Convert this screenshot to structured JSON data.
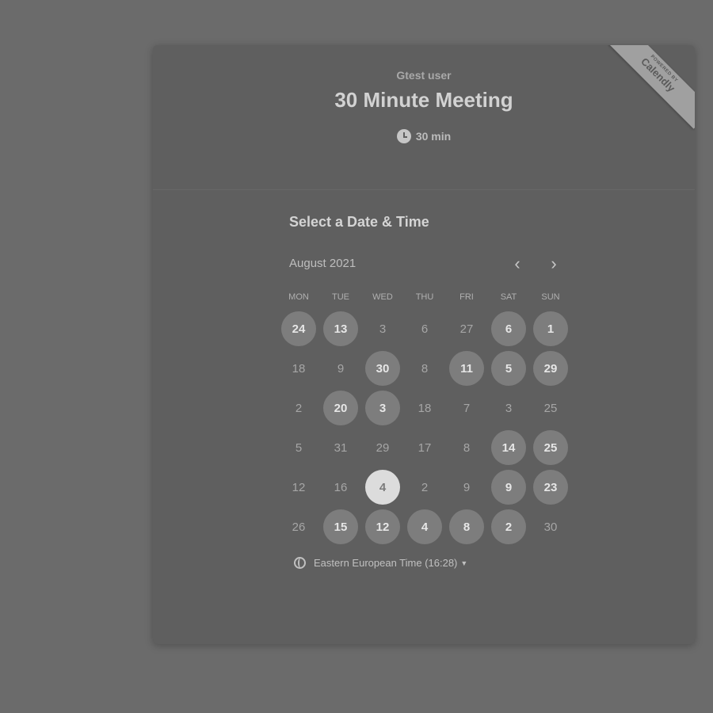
{
  "header": {
    "organizer": "Gtest user",
    "event_title": "30 Minute Meeting",
    "duration": "30 min",
    "ribbon_small": "POWERED BY",
    "ribbon_brand": "Calendly"
  },
  "calendar": {
    "section_title": "Select a Date & Time",
    "month": "August 2021",
    "prev_icon": "‹",
    "next_icon": "›",
    "weekdays": [
      "MON",
      "TUE",
      "WED",
      "THU",
      "FRI",
      "SAT",
      "SUN"
    ],
    "weeks": [
      [
        {
          "label": "24",
          "state": "available"
        },
        {
          "label": "13",
          "state": "available"
        },
        {
          "label": "3",
          "state": "disabled"
        },
        {
          "label": "6",
          "state": "disabled"
        },
        {
          "label": "27",
          "state": "disabled"
        },
        {
          "label": "6",
          "state": "available"
        },
        {
          "label": "1",
          "state": "available"
        }
      ],
      [
        {
          "label": "18",
          "state": "disabled"
        },
        {
          "label": "9",
          "state": "disabled"
        },
        {
          "label": "30",
          "state": "available"
        },
        {
          "label": "8",
          "state": "disabled"
        },
        {
          "label": "11",
          "state": "available"
        },
        {
          "label": "5",
          "state": "available"
        },
        {
          "label": "29",
          "state": "available"
        }
      ],
      [
        {
          "label": "2",
          "state": "disabled"
        },
        {
          "label": "20",
          "state": "available"
        },
        {
          "label": "3",
          "state": "available"
        },
        {
          "label": "18",
          "state": "disabled"
        },
        {
          "label": "7",
          "state": "disabled"
        },
        {
          "label": "3",
          "state": "disabled"
        },
        {
          "label": "25",
          "state": "disabled"
        }
      ],
      [
        {
          "label": "5",
          "state": "disabled"
        },
        {
          "label": "31",
          "state": "disabled"
        },
        {
          "label": "29",
          "state": "disabled"
        },
        {
          "label": "17",
          "state": "disabled"
        },
        {
          "label": "8",
          "state": "disabled"
        },
        {
          "label": "14",
          "state": "available"
        },
        {
          "label": "25",
          "state": "available"
        }
      ],
      [
        {
          "label": "12",
          "state": "disabled"
        },
        {
          "label": "16",
          "state": "disabled"
        },
        {
          "label": "4",
          "state": "selected"
        },
        {
          "label": "2",
          "state": "disabled"
        },
        {
          "label": "9",
          "state": "disabled"
        },
        {
          "label": "9",
          "state": "available"
        },
        {
          "label": "23",
          "state": "available"
        }
      ],
      [
        {
          "label": "26",
          "state": "disabled"
        },
        {
          "label": "15",
          "state": "available"
        },
        {
          "label": "12",
          "state": "available"
        },
        {
          "label": "4",
          "state": "available"
        },
        {
          "label": "8",
          "state": "available"
        },
        {
          "label": "2",
          "state": "available"
        },
        {
          "label": "30",
          "state": "disabled"
        }
      ]
    ]
  },
  "timezone": {
    "label": "Eastern European Time (16:28)",
    "caret": "▼"
  }
}
